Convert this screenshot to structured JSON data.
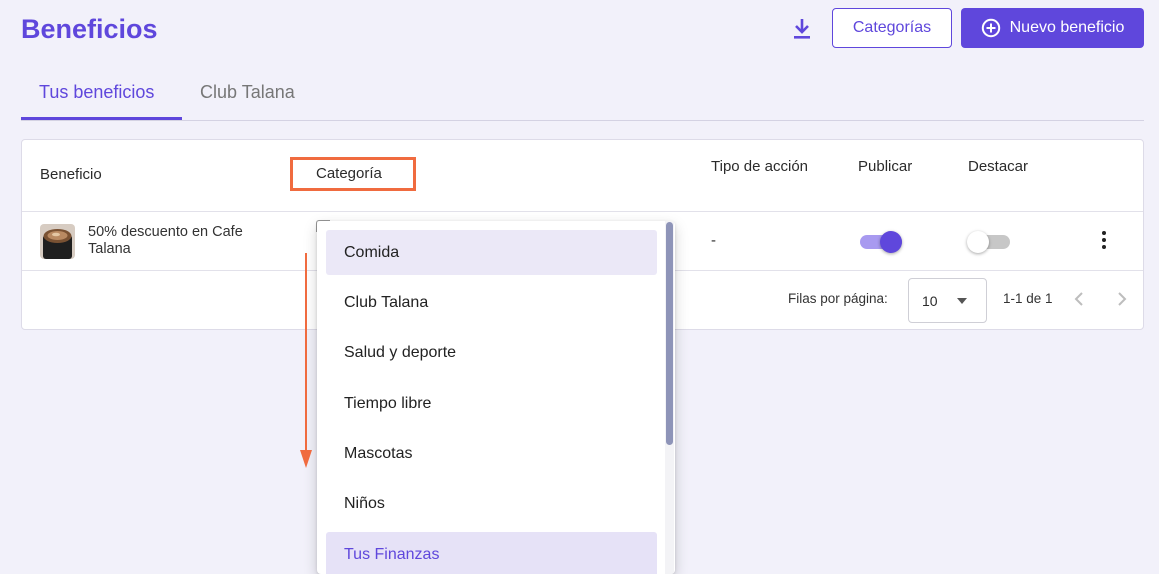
{
  "header": {
    "title": "Beneficios",
    "download_icon": "download-icon",
    "categories_button": "Categorías",
    "new_button": "Nuevo beneficio",
    "new_button_icon": "plus-circle-icon"
  },
  "tabs": [
    {
      "label": "Tus beneficios",
      "active": true
    },
    {
      "label": "Club Talana",
      "active": false
    }
  ],
  "table": {
    "columns": {
      "benefit": "Beneficio",
      "category": "Categoría",
      "action_type": "Tipo de acción",
      "publish": "Publicar",
      "feature": "Destacar"
    },
    "rows": [
      {
        "name": "50% descuento en Cafe Talana",
        "action_type": "-",
        "publish": true,
        "feature": false
      }
    ],
    "pagination": {
      "rows_per_page_label": "Filas por página:",
      "rows_per_page": "10",
      "range": "1-1 de 1"
    }
  },
  "dropdown": {
    "options": [
      "Comida",
      "Club Talana",
      "Salud y deporte",
      "Tiempo libre",
      "Mascotas",
      "Niños",
      "Tus Finanzas"
    ],
    "selected": "Comida"
  },
  "colors": {
    "brand": "#5f47dc",
    "annotation": "#f06b3f",
    "background": "#f2f1fa"
  }
}
